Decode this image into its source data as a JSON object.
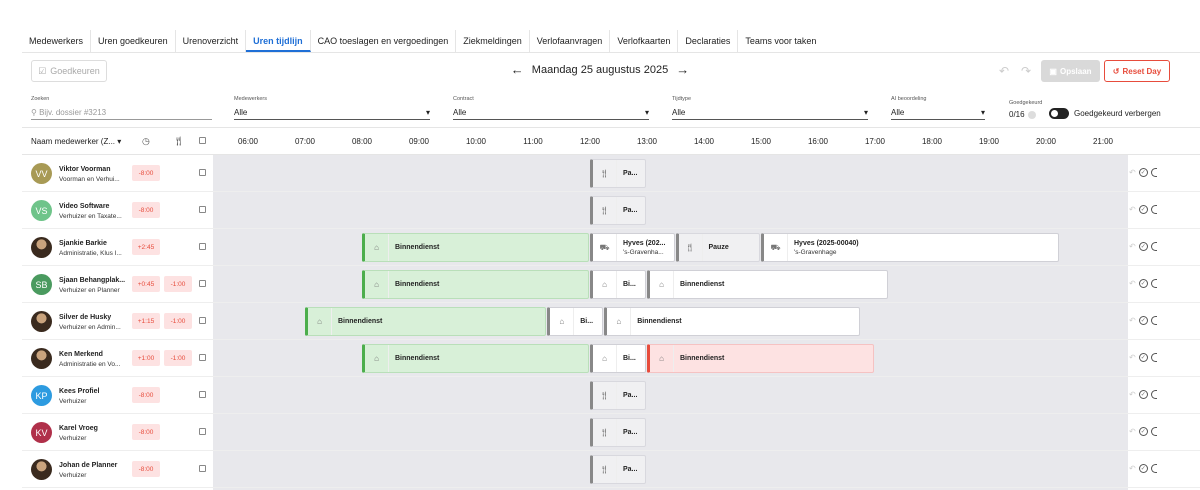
{
  "tabs": [
    "Medewerkers",
    "Uren goedkeuren",
    "Urenoverzicht",
    "Uren tijdlijn",
    "CAO toeslagen en vergoedingen",
    "Ziekmeldingen",
    "Verlofaanvragen",
    "Verlofkaarten",
    "Declaraties",
    "Teams voor taken"
  ],
  "active_tab": "Uren tijdlijn",
  "toolbar": {
    "approve_label": "Goedkeuren",
    "date_label": "Maandag 25 augustus 2025",
    "save_label": "Opslaan",
    "reset_label": "Reset Day"
  },
  "filters": {
    "search_label": "Zoeken",
    "search_placeholder": "Bijv. dossier #3213",
    "employees_label": "Medewerkers",
    "employees_value": "Alle",
    "contract_label": "Contract",
    "contract_value": "Alle",
    "shifttype_label": "Tijdtype",
    "shifttype_value": "Alle",
    "ai_label": "AI beoordeling",
    "ai_value": "Alle",
    "approved_label": "Goedgekeurd",
    "approved_value": "0/16",
    "hide_approved_label": "Goedgekeurd verbergen"
  },
  "grid": {
    "name_header": "Naam medewerker (Z...",
    "hours": [
      "06:00",
      "07:00",
      "08:00",
      "09:00",
      "10:00",
      "11:00",
      "12:00",
      "13:00",
      "14:00",
      "15:00",
      "16:00",
      "17:00",
      "18:00",
      "19:00",
      "20:00",
      "21:00"
    ]
  },
  "employees": [
    {
      "name": "Viktor Voorman",
      "role": "Voorman en Verhui...",
      "initials": "VV",
      "avatar_color": "#a89a55",
      "badges": [
        "-8:00"
      ],
      "blocks": [
        {
          "start": 12.0,
          "end": 13.0,
          "style": "grey",
          "icon": "cutlery-icon",
          "label": "Pa..."
        }
      ]
    },
    {
      "name": "Video Software",
      "role": "Verhuizer en Taxate...",
      "initials": "VS",
      "avatar_color": "#6fc48a",
      "badges": [
        "-8:00"
      ],
      "blocks": [
        {
          "start": 12.0,
          "end": 13.0,
          "style": "grey",
          "icon": "cutlery-icon",
          "label": "Pa..."
        }
      ]
    },
    {
      "name": "Sjankie Barkie",
      "role": "Administratie, Klus I...",
      "initials": "",
      "avatar_color": "",
      "badges": [
        "+2:45"
      ],
      "blocks": [
        {
          "start": 8.0,
          "end": 12.0,
          "style": "green",
          "icon": "warehouse-icon",
          "label": "Binnendienst"
        },
        {
          "start": 12.0,
          "end": 13.5,
          "style": "white",
          "icon": "truck-icon",
          "label": "Hyves (202...",
          "sub": "'s-Gravenha..."
        },
        {
          "start": 13.5,
          "end": 15.0,
          "style": "grey",
          "icon": "cutlery-icon",
          "label": "Pauze"
        },
        {
          "start": 15.0,
          "end": 20.25,
          "style": "white",
          "icon": "truck-icon",
          "label": "Hyves (2025-00040)",
          "sub": "'s-Gravenhage"
        }
      ]
    },
    {
      "name": "Sjaan Behangplak...",
      "role": "Verhuizer en Planner",
      "initials": "SB",
      "avatar_color": "#4a9a5f",
      "badges": [
        "+0:45",
        "-1:00"
      ],
      "blocks": [
        {
          "start": 8.0,
          "end": 12.0,
          "style": "green",
          "icon": "warehouse-icon",
          "label": "Binnendienst"
        },
        {
          "start": 12.0,
          "end": 13.0,
          "style": "white",
          "icon": "warehouse-icon",
          "label": "Bi..."
        },
        {
          "start": 13.0,
          "end": 17.25,
          "style": "white",
          "icon": "warehouse-icon",
          "label": "Binnendienst"
        }
      ]
    },
    {
      "name": "Silver de Husky",
      "role": "Verhuizer en Admin...",
      "initials": "",
      "avatar_color": "",
      "badges": [
        "+1:15",
        "-1:00"
      ],
      "blocks": [
        {
          "start": 7.0,
          "end": 11.25,
          "style": "green",
          "icon": "warehouse-icon",
          "label": "Binnendienst"
        },
        {
          "start": 11.25,
          "end": 12.25,
          "style": "white",
          "icon": "warehouse-icon",
          "label": "Bi..."
        },
        {
          "start": 12.25,
          "end": 16.75,
          "style": "white",
          "icon": "warehouse-icon",
          "label": "Binnendienst"
        }
      ]
    },
    {
      "name": "Ken Merkend",
      "role": "Administratie en Vo...",
      "initials": "",
      "avatar_color": "",
      "badges": [
        "+1:00",
        "-1:00"
      ],
      "blocks": [
        {
          "start": 8.0,
          "end": 12.0,
          "style": "green",
          "icon": "warehouse-icon",
          "label": "Binnendienst"
        },
        {
          "start": 12.0,
          "end": 13.0,
          "style": "white",
          "icon": "warehouse-icon",
          "label": "Bi..."
        },
        {
          "start": 13.0,
          "end": 17.0,
          "style": "red",
          "icon": "warehouse-icon",
          "label": "Binnendienst"
        }
      ]
    },
    {
      "name": "Kees Profiel",
      "role": "Verhuizer",
      "initials": "KP",
      "avatar_color": "#2d9be0",
      "badges": [
        "-8:00"
      ],
      "blocks": [
        {
          "start": 12.0,
          "end": 13.0,
          "style": "grey",
          "icon": "cutlery-icon",
          "label": "Pa..."
        }
      ]
    },
    {
      "name": "Karel Vroeg",
      "role": "Verhuizer",
      "initials": "KV",
      "avatar_color": "#b0304a",
      "badges": [
        "-8:00"
      ],
      "blocks": [
        {
          "start": 12.0,
          "end": 13.0,
          "style": "grey",
          "icon": "cutlery-icon",
          "label": "Pa..."
        }
      ]
    },
    {
      "name": "Johan de Planner",
      "role": "Verhuizer",
      "initials": "",
      "avatar_color": "",
      "badges": [
        "-8:00"
      ],
      "blocks": [
        {
          "start": 12.0,
          "end": 13.0,
          "style": "grey",
          "icon": "cutlery-icon",
          "label": "Pa..."
        }
      ]
    }
  ]
}
